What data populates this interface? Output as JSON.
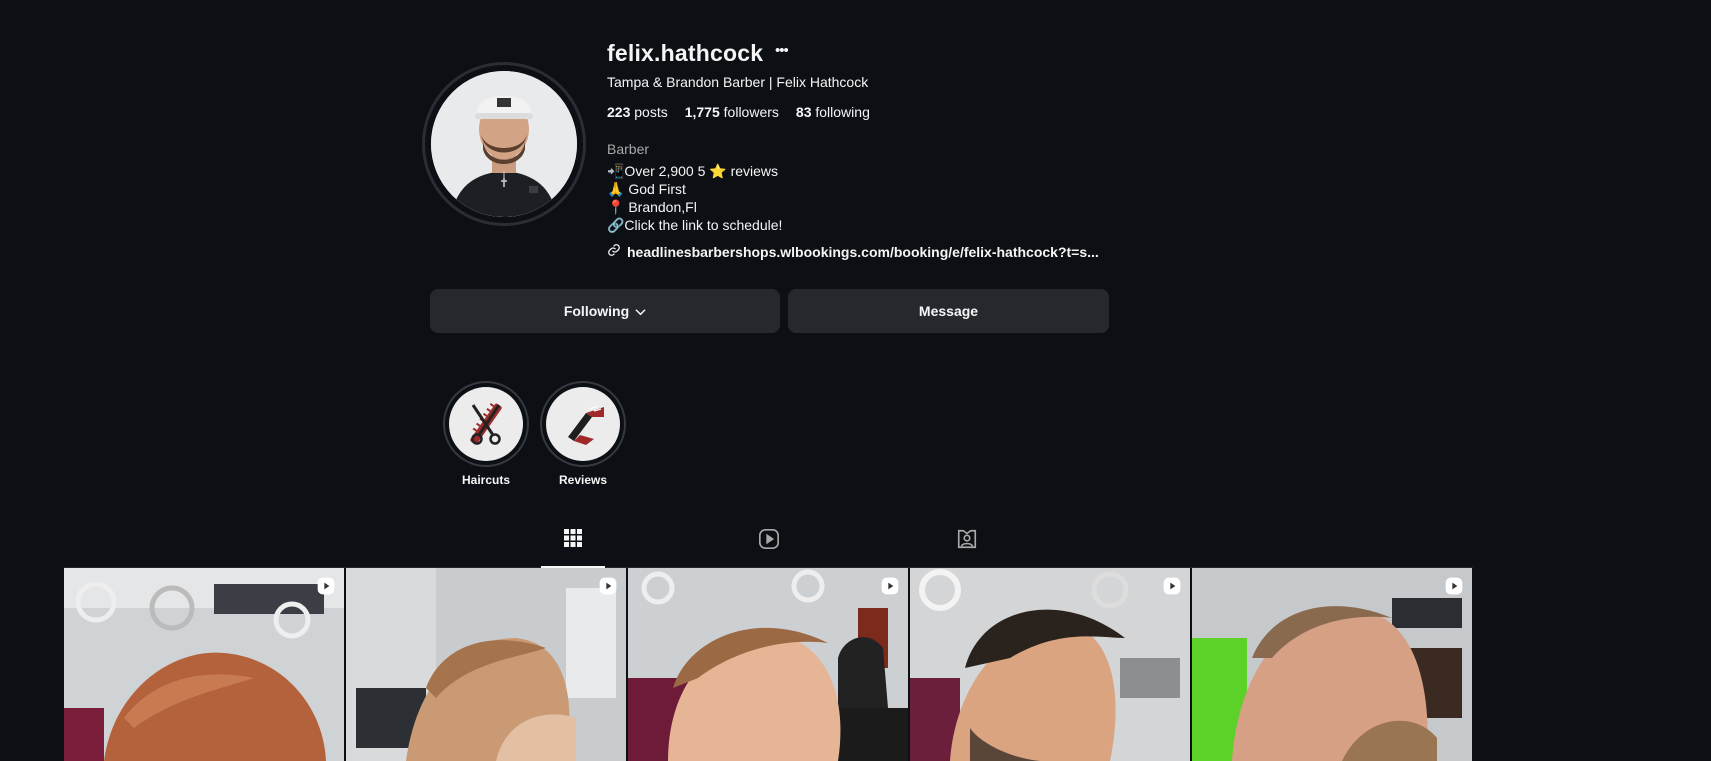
{
  "profile": {
    "username": "felix.hathcock",
    "full_name": "Tampa & Brandon Barber | Felix Hathcock",
    "stats": {
      "posts_count": "223",
      "posts_label": "posts",
      "followers_count": "1,775",
      "followers_label": "followers",
      "following_count": "83",
      "following_label": "following"
    },
    "category": "Barber",
    "bio_lines": [
      "📲Over 2,900 5 ⭐️ reviews",
      "🙏 God First",
      "📍 Brandon,Fl",
      "🔗Click the link to schedule!"
    ],
    "link": "headlinesbarbershops.wlbookings.com/booking/e/felix-hathcock?t=s..."
  },
  "actions": {
    "following_label": "Following",
    "message_label": "Message"
  },
  "highlights": [
    {
      "label": "Haircuts",
      "icon": "scissors-comb-icon"
    },
    {
      "label": "Reviews",
      "icon": "straight-razor-icon"
    }
  ],
  "tabs": [
    {
      "name": "posts",
      "icon": "grid-icon",
      "active": true
    },
    {
      "name": "reels",
      "icon": "reels-icon",
      "active": false
    },
    {
      "name": "tagged",
      "icon": "tagged-user-icon",
      "active": false
    }
  ],
  "posts": [
    {
      "type": "reel",
      "icon": "reel-icon"
    },
    {
      "type": "reel",
      "icon": "reel-icon"
    },
    {
      "type": "reel",
      "icon": "reel-icon"
    },
    {
      "type": "reel",
      "icon": "reel-icon"
    },
    {
      "type": "reel",
      "icon": "reel-icon"
    }
  ],
  "colors": {
    "background": "#0c1014",
    "button": "#25292e",
    "text": "#f5f5f5",
    "muted": "#a8a8a8"
  }
}
